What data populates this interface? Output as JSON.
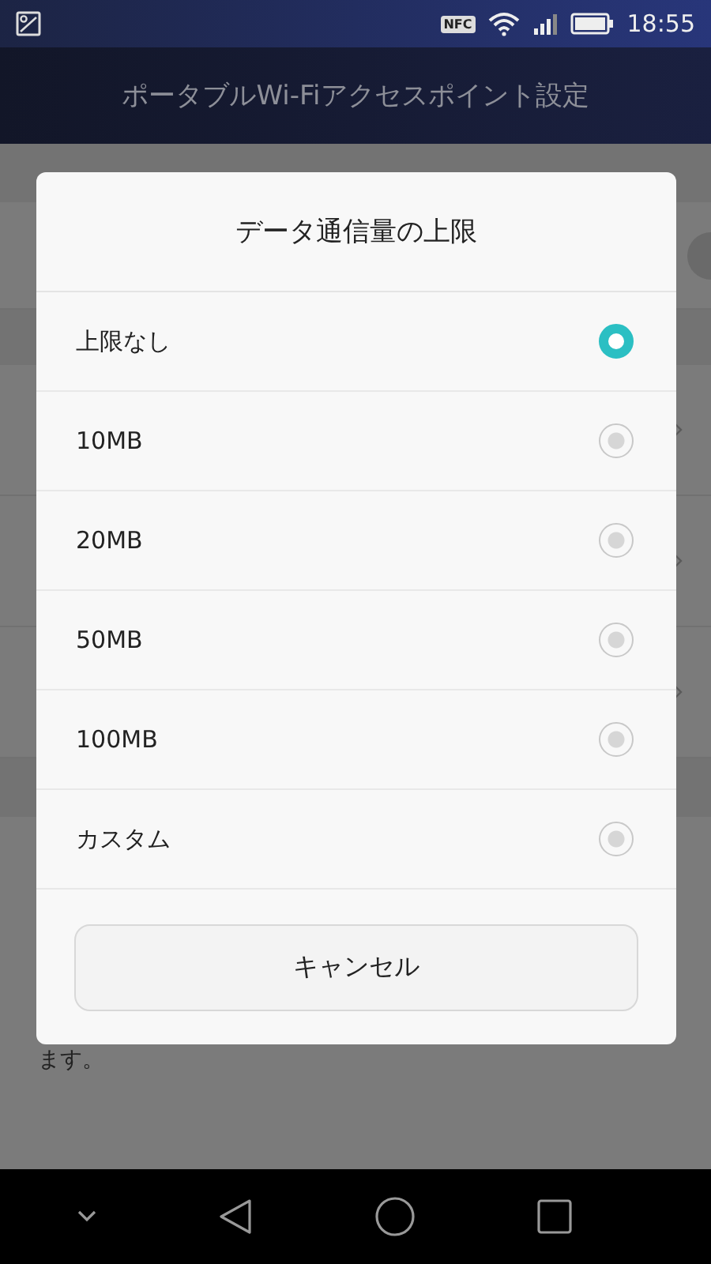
{
  "status_bar": {
    "time": "18:55",
    "nfc": "NFC"
  },
  "title_bar": {
    "title": "ポータブルWi-Fiアクセスポイント設定"
  },
  "background": {
    "note_tail": "ます。"
  },
  "dialog": {
    "title": "データ通信量の上限",
    "options": [
      {
        "label": "上限なし",
        "selected": true
      },
      {
        "label": "10MB",
        "selected": false
      },
      {
        "label": "20MB",
        "selected": false
      },
      {
        "label": "50MB",
        "selected": false
      },
      {
        "label": "100MB",
        "selected": false
      },
      {
        "label": "カスタム",
        "selected": false
      }
    ],
    "cancel": "キャンセル"
  }
}
